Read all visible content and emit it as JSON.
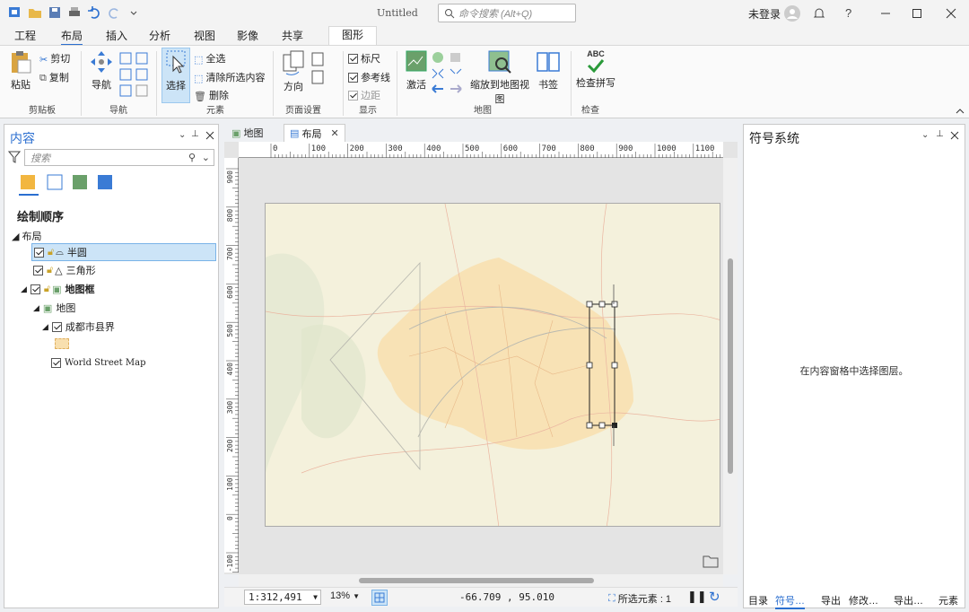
{
  "titlebar": {
    "title": "Untitled",
    "search_placeholder": "命令搜索 (Alt+Q)",
    "user": "未登录"
  },
  "tabs": [
    "工程",
    "布局",
    "插入",
    "分析",
    "视图",
    "影像",
    "共享",
    "图形"
  ],
  "ribbon": {
    "clipboard": {
      "paste": "粘贴",
      "cut": "剪切",
      "copy": "复制",
      "group": "剪贴板"
    },
    "nav": {
      "navigate": "导航",
      "group": "导航"
    },
    "elements": {
      "select": "选择",
      "select_all": "全选",
      "clear_selection": "清除所选内容",
      "delete": "删除",
      "group": "元素"
    },
    "page_setup": {
      "orientation": "方向",
      "group": "页面设置"
    },
    "show": {
      "rulers": "标尺",
      "guides": "参考线",
      "margins": "边距",
      "group": "显示"
    },
    "map": {
      "activate": "激活",
      "zoom_to_map": "缩放到地图视图",
      "bookmarks": "书签",
      "group": "地图"
    },
    "review": {
      "spell": "检查拼写",
      "abc": "ABC",
      "group": "检查"
    }
  },
  "contents": {
    "title": "内容",
    "search_placeholder": "搜索",
    "drawing_order": "绘制顺序",
    "layout": "布局",
    "items": {
      "semicircle": "半圆",
      "triangle": "三角形",
      "map_frame": "地图框",
      "map": "地图",
      "chengdu": "成都市县界",
      "basemap": "World Street Map"
    }
  },
  "doc_tabs": {
    "map": "地图",
    "layout": "布局"
  },
  "ruler": {
    "h_ticks": [
      "0",
      "100",
      "200",
      "300",
      "400",
      "500",
      "600",
      "700",
      "800",
      "900",
      "1000",
      "1100"
    ],
    "v_ticks": [
      "900",
      "800",
      "700",
      "600",
      "500",
      "400",
      "300",
      "200",
      "100",
      "0",
      "-100"
    ]
  },
  "status": {
    "scale": "1:312,491",
    "zoom": "13%",
    "coords": "-66.709 , 95.010",
    "selected": "所选元素 : 1"
  },
  "symbology": {
    "title": "符号系统",
    "empty_message": "在内容窗格中选择图层。"
  },
  "bottom_tabs": [
    "目录",
    "符号…",
    "导出",
    "修改…",
    "导出…",
    "元素"
  ],
  "colors": {
    "accent": "#2b6fd0",
    "selection_bg": "#cce4f7",
    "map_fill": "#f8dfae"
  }
}
